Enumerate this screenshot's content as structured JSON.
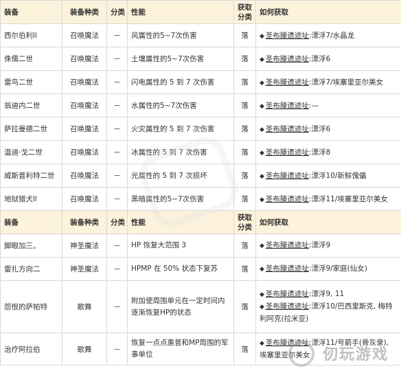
{
  "header1": {
    "c1": "装备",
    "c2": "装备种类",
    "c3": "分类",
    "c4": "性能",
    "c5": "获取分类",
    "c6": "如何获取"
  },
  "rows1": [
    {
      "name": "西尔伯利ll",
      "kind": "召唤魔法",
      "cls": "－",
      "perf": "风属性的5~7次伤害",
      "get": "落",
      "loc": "圣布滕遗迹址",
      "detail": ":漂浮7/水晶龙"
    },
    {
      "name": "侏儒二世",
      "kind": "召唤魔法",
      "cls": "－",
      "perf": "土壤属性的5~7次伤害",
      "get": "落",
      "loc": "圣布滕遗迹址",
      "detail": ":漂浮6"
    },
    {
      "name": "雷鸟二世",
      "kind": "召唤魔法",
      "cls": "－",
      "perf": "闪电属性的 5 到 7 次伤害",
      "get": "落",
      "loc": "圣布滕遗迹址",
      "detail": ":漂浮7/埃塞里亚尔美女"
    },
    {
      "name": "翁迪内二世",
      "kind": "召唤魔法",
      "cls": "－",
      "perf": "水属性的5~7次伤害",
      "get": "落",
      "loc": "圣布滕遗迹址",
      "detail": ":—"
    },
    {
      "name": "萨拉曼德二世",
      "kind": "召唤魔法",
      "cls": "－",
      "perf": "火灾属性的 5 到 7 次伤害",
      "get": "落",
      "loc": "圣布滕遗迹址",
      "detail": ":漂浮6"
    },
    {
      "name": "温迪·戈二世",
      "kind": "召唤魔法",
      "cls": "－",
      "perf": "冰属性的 5 到 7 次伤害",
      "get": "落",
      "loc": "圣布滕遗迹址",
      "detail": ":漂浮8"
    },
    {
      "name": "威斯普利特二世",
      "kind": "召唤魔法",
      "cls": "－",
      "perf": "光属性的 5 到 7 次损坏",
      "get": "落",
      "loc": "圣布滕遗迹址",
      "detail": ":漂浮10/新鲜傀儡"
    },
    {
      "name": "地狱猎犬ll",
      "kind": "召唤魔法",
      "cls": "－",
      "perf": "黑暗属性的5~7次伤害",
      "get": "落",
      "loc": "圣布滕遗迹址",
      "detail": ":漂浮11/埃塞里亚尔美女"
    }
  ],
  "header2": {
    "c1": "装备",
    "c2": "装备种类",
    "c3": "分类",
    "c4": "性能",
    "c5": "获取分类",
    "c6": "如何获取"
  },
  "rows2": [
    {
      "name": "脚眼加三。",
      "kind": "神圣魔法",
      "cls": "－",
      "perf": "HP 恢复大范围 3",
      "get": "落",
      "lines": [
        {
          "loc": "圣布滕遗迹址",
          "detail": ":漂浮9"
        }
      ]
    },
    {
      "name": "雷扎方向二",
      "kind": "神圣魔法",
      "cls": "－",
      "perf": "HPMP 在 50% 状态下复苏",
      "get": "落",
      "lines": [
        {
          "loc": "圣布滕遗迹址",
          "detail": ":漂浮9/家庭(仙女)"
        }
      ]
    },
    {
      "name": "怨恨的萨帕特",
      "kind": "歌舞",
      "cls": "－",
      "perf": "附加使周围单元在一定时间内逐渐恢复HP的状态",
      "get": "落",
      "lines": [
        {
          "loc": "圣布滕遗迹址",
          "detail": ":漂浮9, 11"
        },
        {
          "loc": "圣布滕遗迹址",
          "detail": ":漂浮10/巴西里斯克, 梅特利阿克(拉米亚)"
        }
      ]
    },
    {
      "name": "治疗阿拉伯",
      "kind": "歌舞",
      "cls": "－",
      "perf": "恢复一点点惠普和MP周围的军事单位",
      "get": "落",
      "lines": [
        {
          "loc": "圣布滕遗迹址",
          "detail": ":漂浮11/号箭手(骨灰录), 埃塞里亚尔美女"
        }
      ]
    }
  ],
  "watermark": "仞玩游戏"
}
